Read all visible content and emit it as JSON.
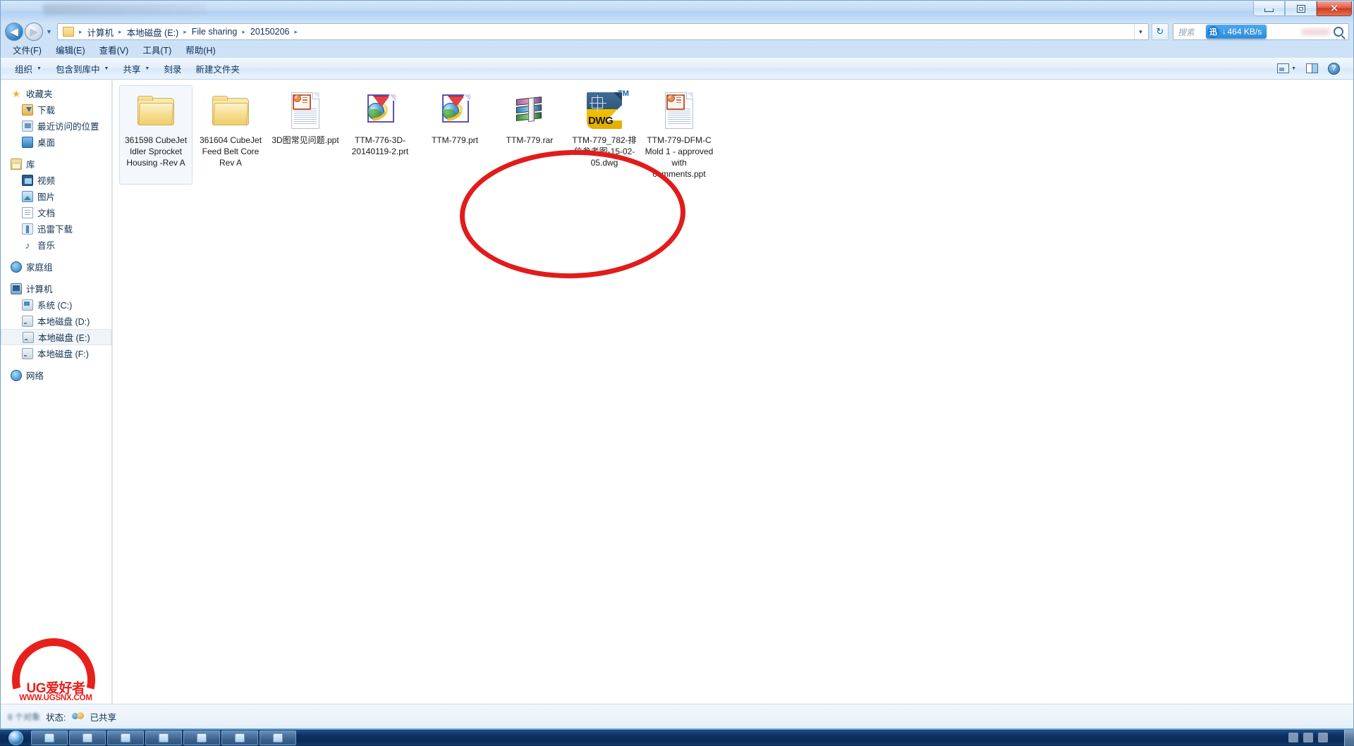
{
  "window": {
    "title_text": "",
    "buttons": {
      "minimize": "–",
      "maximize": "❐",
      "close": "✕"
    }
  },
  "nav": {
    "back_glyph": "◀",
    "forward_glyph": "▶",
    "history_glyph": "▼",
    "refresh_glyph": "↻",
    "address_dropdown_glyph": "▼",
    "breadcrumbs": [
      "计算机",
      "本地磁盘 (E:)",
      "File sharing",
      "20150206"
    ],
    "crumb_separator": "▸"
  },
  "search": {
    "placeholder": "搜索",
    "icon": "search-icon"
  },
  "download_overlay": {
    "app_initial": "迅",
    "arrow": "↓",
    "speed": "464 KB/s"
  },
  "menu": {
    "items": [
      "文件(F)",
      "编辑(E)",
      "查看(V)",
      "工具(T)",
      "帮助(H)"
    ]
  },
  "toolbar": {
    "organize": "组织",
    "include_in_library": "包含到库中",
    "share": "共享",
    "burn": "刻录",
    "new_folder": "新建文件夹",
    "caret": "▼",
    "help_glyph": "?"
  },
  "sidebar": {
    "groups": [
      {
        "header": {
          "label": "收藏夹",
          "icon": "star-icon"
        },
        "items": [
          {
            "label": "下载",
            "icon": "download-icon"
          },
          {
            "label": "最近访问的位置",
            "icon": "recent-places-icon"
          },
          {
            "label": "桌面",
            "icon": "desktop-icon"
          }
        ]
      },
      {
        "header": {
          "label": "库",
          "icon": "library-icon"
        },
        "items": [
          {
            "label": "视频",
            "icon": "video-icon"
          },
          {
            "label": "图片",
            "icon": "picture-icon"
          },
          {
            "label": "文档",
            "icon": "document-icon"
          },
          {
            "label": "迅雷下载",
            "icon": "thunder-download-icon"
          },
          {
            "label": "音乐",
            "icon": "music-icon"
          }
        ]
      },
      {
        "header": {
          "label": "家庭组",
          "icon": "homegroup-icon"
        },
        "items": []
      },
      {
        "header": {
          "label": "计算机",
          "icon": "computer-icon"
        },
        "items": [
          {
            "label": "系统 (C:)",
            "icon": "system-drive-icon"
          },
          {
            "label": "本地磁盘 (D:)",
            "icon": "drive-icon"
          },
          {
            "label": "本地磁盘 (E:)",
            "icon": "drive-icon",
            "selected": true
          },
          {
            "label": "本地磁盘 (F:)",
            "icon": "drive-icon"
          }
        ]
      },
      {
        "header": {
          "label": "网络",
          "icon": "network-icon"
        },
        "items": []
      }
    ]
  },
  "files": [
    {
      "name": "361598 CubeJet Idler Sprocket Housing -Rev A",
      "type": "folder",
      "selected": true
    },
    {
      "name": "361604 CubeJet Feed Belt Core Rev A",
      "type": "folder",
      "selected": false
    },
    {
      "name": "3D图常见问题.ppt",
      "type": "ppt",
      "selected": false
    },
    {
      "name": "TTM-776-3D-20140119-2.prt",
      "type": "prt",
      "selected": false
    },
    {
      "name": "TTM-779.prt",
      "type": "prt",
      "selected": false
    },
    {
      "name": "TTM-779.rar",
      "type": "rar",
      "selected": false
    },
    {
      "name": "TTM-779_782-排位参考图-15-02-05.dwg",
      "type": "dwg",
      "tm": "TM",
      "dwg_text": "DWG",
      "selected": false
    },
    {
      "name": "TTM-779-DFM-C Mold 1 - approved with comments.ppt",
      "type": "ppt",
      "selected": false
    }
  ],
  "annotation": {
    "shape": "ellipse",
    "color": "#e21b1b",
    "encircles": [
      "TTM-776-3D-20140119-2.prt",
      "TTM-779.prt",
      "TTM-779.rar"
    ]
  },
  "status_bar": {
    "item_count": "8 个对象",
    "state_label": "状态:",
    "shared_value": "已共享",
    "share_icon": "shared-users-icon"
  },
  "watermark": {
    "title": "UG爱好者",
    "url": "WWW.UGSNX.COM",
    "color": "#e8201c"
  },
  "taskbar": {
    "start_label": "start-orb",
    "buttons": [
      "task-1",
      "task-2",
      "task-3",
      "task-4",
      "task-5",
      "task-6",
      "task-7"
    ],
    "tray_time": ""
  }
}
